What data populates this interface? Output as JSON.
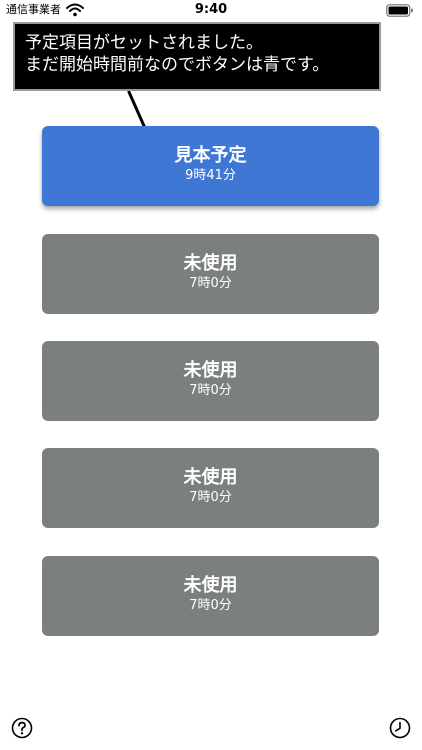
{
  "status_bar": {
    "carrier": "通信事業者",
    "time": "9:40"
  },
  "callout": {
    "line1": "予定項目がセットされました。",
    "line2": "まだ開始時間前なのでボタンは青です。"
  },
  "slots": [
    {
      "title": "見本予定",
      "time": "9時41分",
      "state": "active"
    },
    {
      "title": "未使用",
      "time": "7時0分",
      "state": "unused"
    },
    {
      "title": "未使用",
      "time": "7時0分",
      "state": "unused"
    },
    {
      "title": "未使用",
      "time": "7時0分",
      "state": "unused"
    },
    {
      "title": "未使用",
      "time": "7時0分",
      "state": "unused"
    }
  ],
  "colors": {
    "active": "#3f77d4",
    "unused": "#7b807f"
  },
  "icons": {
    "help": "question-circle-icon",
    "history": "clock-icon"
  }
}
